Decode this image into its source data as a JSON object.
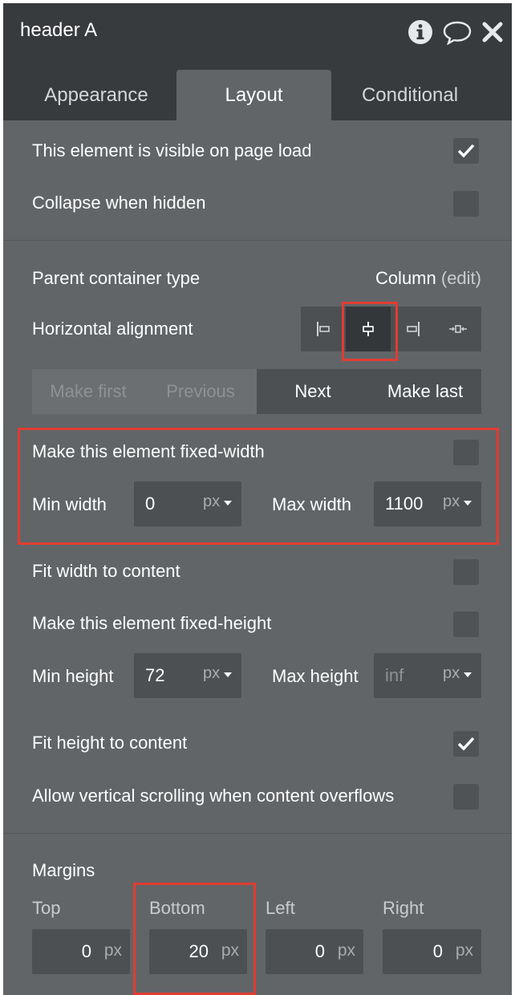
{
  "header": {
    "title": "header A",
    "icons": [
      "info-icon",
      "comment-icon",
      "close-icon"
    ]
  },
  "tabs": [
    {
      "label": "Appearance",
      "active": false
    },
    {
      "label": "Layout",
      "active": true
    },
    {
      "label": "Conditional",
      "active": false
    }
  ],
  "visibility": {
    "visible_on_load_label": "This element is visible on page load",
    "visible_on_load_checked": true,
    "collapse_label": "Collapse when hidden",
    "collapse_checked": false
  },
  "container": {
    "type_label": "Parent container type",
    "type_value": "Column",
    "edit_label": "(edit)",
    "alignment_label": "Horizontal alignment",
    "alignment_options": [
      "align-left-icon",
      "align-center-icon",
      "align-right-icon",
      "align-distribute-icon"
    ],
    "alignment_selected": "align-center-icon"
  },
  "order": {
    "make_first": "Make first",
    "previous": "Previous",
    "next": "Next",
    "make_last": "Make last"
  },
  "width": {
    "fixed_label": "Make this element fixed-width",
    "fixed_checked": false,
    "min_label": "Min width",
    "min_value": "0",
    "min_unit": "px",
    "max_label": "Max width",
    "max_value": "1100",
    "max_unit": "px",
    "fit_label": "Fit width to content",
    "fit_checked": false
  },
  "height": {
    "fixed_label": "Make this element fixed-height",
    "fixed_checked": false,
    "min_label": "Min height",
    "min_value": "72",
    "min_unit": "px",
    "max_label": "Max height",
    "max_placeholder": "inf",
    "max_unit": "px",
    "fit_label": "Fit height to content",
    "fit_checked": true,
    "scroll_label": "Allow vertical scrolling when content overflows",
    "scroll_checked": false
  },
  "margins": {
    "title": "Margins",
    "top_label": "Top",
    "top_value": "0",
    "bottom_label": "Bottom",
    "bottom_value": "20",
    "left_label": "Left",
    "left_value": "0",
    "right_label": "Right",
    "right_value": "0",
    "unit": "px"
  },
  "colors": {
    "panel_bg": "#616568",
    "header_bg": "#383b3e",
    "highlight": "#e03c31"
  }
}
